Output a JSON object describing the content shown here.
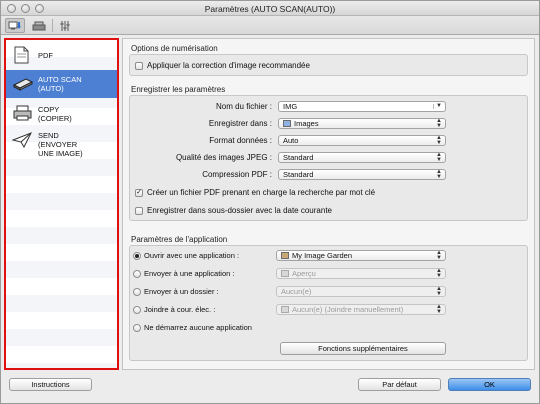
{
  "window": {
    "title": "Paramètres (AUTO SCAN(AUTO))"
  },
  "toolbar": {
    "tabs": [
      {
        "icon": "scan-from-computer-icon"
      },
      {
        "icon": "scan-from-operation-panel-icon"
      },
      {
        "icon": "general-settings-icon"
      }
    ]
  },
  "sidebar": {
    "items": [
      {
        "label": "PDF",
        "icon": "pdf-document-icon"
      },
      {
        "label": "AUTO SCAN\n(AUTO)",
        "icon": "auto-scan-icon",
        "selected": true
      },
      {
        "label": "COPY\n(COPIER)",
        "icon": "copy-printer-icon"
      },
      {
        "label": "SEND\n(ENVOYER\nUNE IMAGE)",
        "icon": "send-paper-plane-icon"
      }
    ]
  },
  "scan_options": {
    "title": "Options de numérisation",
    "apply_correction": "Appliquer la correction d'image recommandée",
    "apply_correction_checked": false
  },
  "save_settings": {
    "title": "Enregistrer les paramètres",
    "file_name_label": "Nom du fichier :",
    "file_name_value": "IMG",
    "save_in_label": "Enregistrer dans :",
    "save_in_value": "Images",
    "data_format_label": "Format données :",
    "data_format_value": "Auto",
    "jpeg_quality_label": "Qualité des images JPEG :",
    "jpeg_quality_value": "Standard",
    "pdf_compression_label": "Compression PDF :",
    "pdf_compression_value": "Standard",
    "searchable_pdf": "Créer un fichier PDF prenant en charge la recherche par mot clé",
    "searchable_pdf_checked": true,
    "subfolder_date": "Enregistrer dans sous-dossier avec la date courante",
    "subfolder_date_checked": false
  },
  "app_settings": {
    "title": "Paramètres de l'application",
    "open_with_label": "Ouvrir avec une application :",
    "open_with_value": "My Image Garden",
    "send_to_app_label": "Envoyer à une application :",
    "send_to_app_value": "Aperçu",
    "send_to_folder_label": "Envoyer à un dossier :",
    "send_to_folder_value": "Aucun(e)",
    "attach_email_label": "Joindre à cour. élec. :",
    "attach_email_value": "Aucun(e) (Joindre manuellement)",
    "do_not_start_label": "Ne démarrez aucune application",
    "more_functions": "Fonctions supplémentaires",
    "selected_option": "open_with"
  },
  "footer": {
    "instructions": "Instructions",
    "defaults": "Par défaut",
    "ok": "OK"
  }
}
